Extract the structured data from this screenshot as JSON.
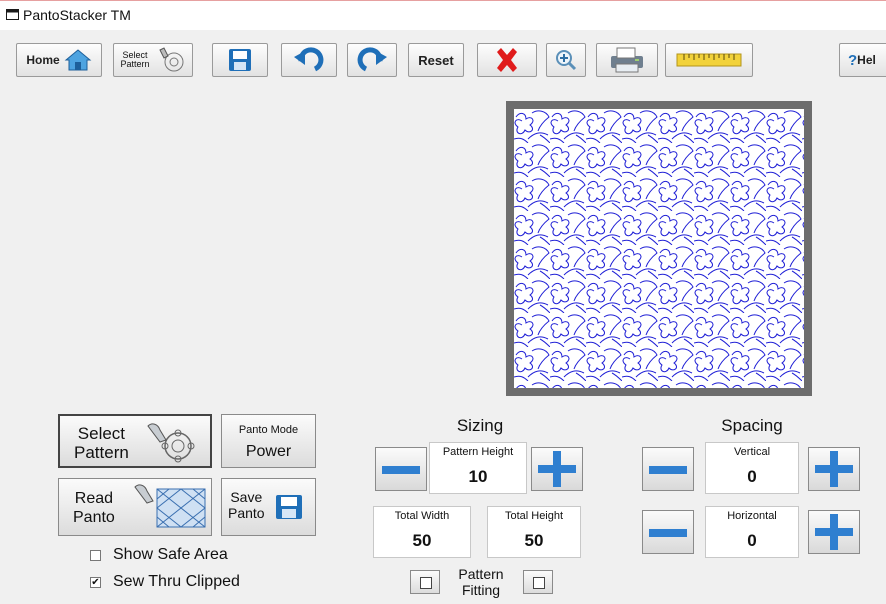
{
  "window": {
    "title": "PantoStacker TM"
  },
  "toolbar": {
    "home_label": "Home",
    "select_pattern_line1": "Select",
    "select_pattern_line2": "Pattern",
    "reset_label": "Reset",
    "help_label": "Hel",
    "help_q": "?"
  },
  "left_panel": {
    "select_pattern_line1": "Select",
    "select_pattern_line2": "Pattern",
    "panto_mode_label": "Panto Mode",
    "panto_mode_value": "Power",
    "read_panto_line1": "Read",
    "read_panto_line2": "Panto",
    "save_panto_line1": "Save",
    "save_panto_line2": "Panto",
    "show_safe_area_label": "Show Safe Area",
    "show_safe_area_checked": false,
    "sew_thru_clipped_label": "Sew Thru Clipped",
    "sew_thru_clipped_checked": true
  },
  "sizing": {
    "title": "Sizing",
    "pattern_height_label": "Pattern Height",
    "pattern_height_value": "10",
    "total_width_label": "Total Width",
    "total_width_value": "50",
    "total_height_label": "Total Height",
    "total_height_value": "50",
    "pattern_fitting_line1": "Pattern",
    "pattern_fitting_line2": "Fitting"
  },
  "spacing": {
    "title": "Spacing",
    "vertical_label": "Vertical",
    "vertical_value": "0",
    "horizontal_label": "Horizontal",
    "horizontal_value": "0"
  },
  "colors": {
    "pattern_stroke": "#1f1fd6",
    "plus_minus_blue": "#2f7fd0",
    "delete_red": "#e01b1b",
    "frame_gray": "#6d6d6d"
  }
}
